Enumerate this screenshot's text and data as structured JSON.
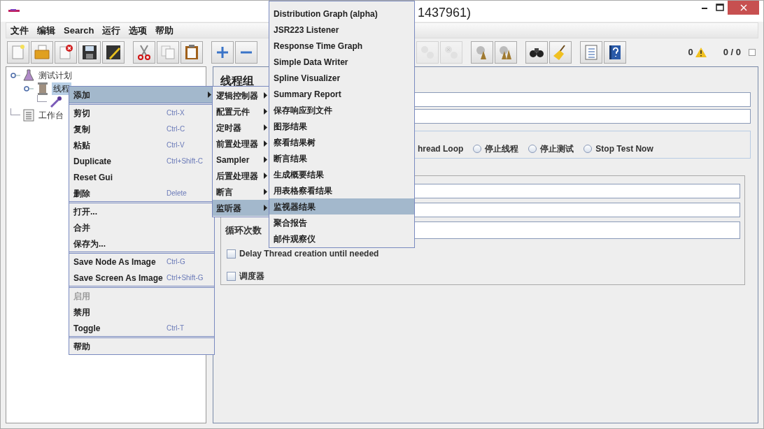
{
  "window": {
    "title": "1437961)"
  },
  "menubar": [
    "文件",
    "编辑",
    "Search",
    "运行",
    "选项",
    "帮助"
  ],
  "toolbar": {
    "groups": [
      [
        {
          "kind": "new",
          "disabled": false
        },
        {
          "kind": "open",
          "disabled": false
        },
        {
          "kind": "close",
          "disabled": false
        },
        {
          "kind": "save",
          "disabled": false
        },
        {
          "kind": "save-as",
          "disabled": false
        }
      ],
      [
        {
          "kind": "cut",
          "disabled": false
        },
        {
          "kind": "copy",
          "disabled": false
        },
        {
          "kind": "paste",
          "disabled": false
        }
      ],
      [
        {
          "kind": "expand",
          "disabled": false
        },
        {
          "kind": "collapse",
          "disabled": false
        }
      ],
      [
        {
          "kind": "remote-start",
          "disabled": true
        },
        {
          "kind": "remote-stop",
          "disabled": true
        }
      ],
      [
        {
          "kind": "clear",
          "disabled": false
        },
        {
          "kind": "clear-all",
          "disabled": false
        }
      ],
      [
        {
          "kind": "search",
          "disabled": false
        },
        {
          "kind": "reset",
          "disabled": false
        }
      ],
      [
        {
          "kind": "function",
          "disabled": false
        },
        {
          "kind": "help",
          "disabled": false
        }
      ]
    ],
    "warnings": "0",
    "counts": "0 / 0"
  },
  "tree": [
    {
      "label": "测试计划",
      "kind": "plan",
      "selected": false,
      "children": [
        {
          "label": "线程",
          "kind": "thread",
          "selected": true,
          "children": [
            {
              "kind": "sampler"
            }
          ]
        }
      ]
    },
    {
      "label": "工作台",
      "kind": "workbench",
      "selected": false
    }
  ],
  "panel": {
    "title": "线程组",
    "on_error": [
      {
        "label": "hread Loop"
      },
      {
        "label": "停止线程",
        "selected": false
      },
      {
        "label": "停止测试",
        "selected": false
      },
      {
        "label": "Stop Test Now",
        "selected": false
      }
    ],
    "loop_label": "循环次数",
    "checkboxes": [
      {
        "label": "Delay Thread creation until needed",
        "checked": false
      },
      {
        "label": "调度器",
        "checked": false
      }
    ]
  },
  "context_menu": [
    [
      {
        "label": "添加",
        "submenu": true,
        "selected": true,
        "disabled": false
      }
    ],
    [
      {
        "label": "剪切",
        "shortcut": "Ctrl-X",
        "submenu": false,
        "selected": false,
        "disabled": false
      },
      {
        "label": "复制",
        "shortcut": "Ctrl-C",
        "submenu": false,
        "selected": false,
        "disabled": false
      },
      {
        "label": "粘贴",
        "shortcut": "Ctrl-V",
        "submenu": false,
        "selected": false,
        "disabled": false
      },
      {
        "label": "Duplicate",
        "shortcut": "Ctrl+Shift-C",
        "submenu": false,
        "selected": false,
        "disabled": false
      },
      {
        "label": "Reset Gui",
        "submenu": false,
        "selected": false,
        "disabled": false
      },
      {
        "label": "删除",
        "shortcut": "Delete",
        "submenu": false,
        "selected": false,
        "disabled": false
      }
    ],
    [
      {
        "label": "打开...",
        "submenu": false,
        "selected": false,
        "disabled": false
      },
      {
        "label": "合并",
        "submenu": false,
        "selected": false,
        "disabled": false
      },
      {
        "label": "保存为...",
        "submenu": false,
        "selected": false,
        "disabled": false
      }
    ],
    [
      {
        "label": "Save Node As Image",
        "shortcut": "Ctrl-G",
        "submenu": false,
        "selected": false,
        "disabled": false
      },
      {
        "label": "Save Screen As Image",
        "shortcut": "Ctrl+Shift-G",
        "submenu": false,
        "selected": false,
        "disabled": false
      }
    ],
    [
      {
        "label": "启用",
        "submenu": false,
        "selected": false,
        "disabled": true
      },
      {
        "label": "禁用",
        "submenu": false,
        "selected": false,
        "disabled": false
      },
      {
        "label": "Toggle",
        "shortcut": "Ctrl-T",
        "submenu": false,
        "selected": false,
        "disabled": false
      }
    ],
    [
      {
        "label": "帮助",
        "submenu": false,
        "selected": false,
        "disabled": false
      }
    ]
  ],
  "add_submenu": [
    {
      "label": "逻辑控制器",
      "selected": false
    },
    {
      "label": "配置元件",
      "selected": false
    },
    {
      "label": "定时器",
      "selected": false
    },
    {
      "label": "前置处理器",
      "selected": false
    },
    {
      "label": "Sampler",
      "selected": false
    },
    {
      "label": "后置处理器",
      "selected": false
    },
    {
      "label": "断言",
      "selected": false
    },
    {
      "label": "监听器",
      "selected": true
    }
  ],
  "listener_submenu": [
    {
      "label": "Distribution Graph (alpha)",
      "selected": false
    },
    {
      "label": "JSR223 Listener",
      "selected": false
    },
    {
      "label": "Response Time Graph",
      "selected": false
    },
    {
      "label": "Simple Data Writer",
      "selected": false
    },
    {
      "label": "Spline Visualizer",
      "selected": false
    },
    {
      "label": "Summary Report",
      "selected": false
    },
    {
      "label": "保存响应到文件",
      "selected": false
    },
    {
      "label": "图形结果",
      "selected": false
    },
    {
      "label": "察看结果树",
      "selected": false
    },
    {
      "label": "断言结果",
      "selected": false
    },
    {
      "label": "生成概要结果",
      "selected": false
    },
    {
      "label": "用表格察看结果",
      "selected": false
    },
    {
      "label": "监视器结果",
      "selected": true
    },
    {
      "label": "聚合报告",
      "selected": false
    },
    {
      "label": "邮件观察仪",
      "selected": false
    }
  ]
}
